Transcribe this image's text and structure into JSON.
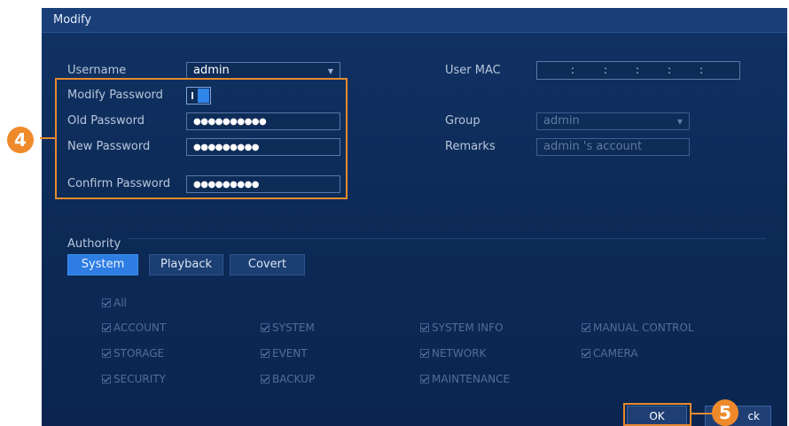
{
  "dialog": {
    "title": "Modify"
  },
  "form": {
    "username": {
      "label": "Username",
      "value": "admin"
    },
    "modify_password": {
      "label": "Modify Password"
    },
    "old_password": {
      "label": "Old Password",
      "value": "●●●●●●●●●●"
    },
    "new_password": {
      "label": "New Password",
      "value": "●●●●●●●●●"
    },
    "confirm_password": {
      "label": "Confirm Password",
      "value": "●●●●●●●●●"
    },
    "user_mac": {
      "label": "User MAC",
      "separators": [
        ":",
        ":",
        ":",
        ":",
        ":"
      ]
    },
    "group": {
      "label": "Group",
      "value": "admin"
    },
    "remarks": {
      "label": "Remarks",
      "value": "admin 's account"
    }
  },
  "authority": {
    "label": "Authority",
    "tabs": [
      "System",
      "Playback",
      "Covert"
    ],
    "all_label": "All",
    "permissions": [
      "ACCOUNT",
      "SYSTEM",
      "SYSTEM INFO",
      "MANUAL CONTROL",
      "STORAGE",
      "EVENT",
      "NETWORK",
      "CAMERA",
      "SECURITY",
      "BACKUP",
      "MAINTENANCE"
    ]
  },
  "buttons": {
    "ok": "OK",
    "back": "ck"
  },
  "callouts": {
    "step4": "4",
    "step5": "5"
  },
  "colors": {
    "callout": "#ef8a2b",
    "dialog_bg": "#0d2b58",
    "tab_active": "#2e7de3"
  }
}
